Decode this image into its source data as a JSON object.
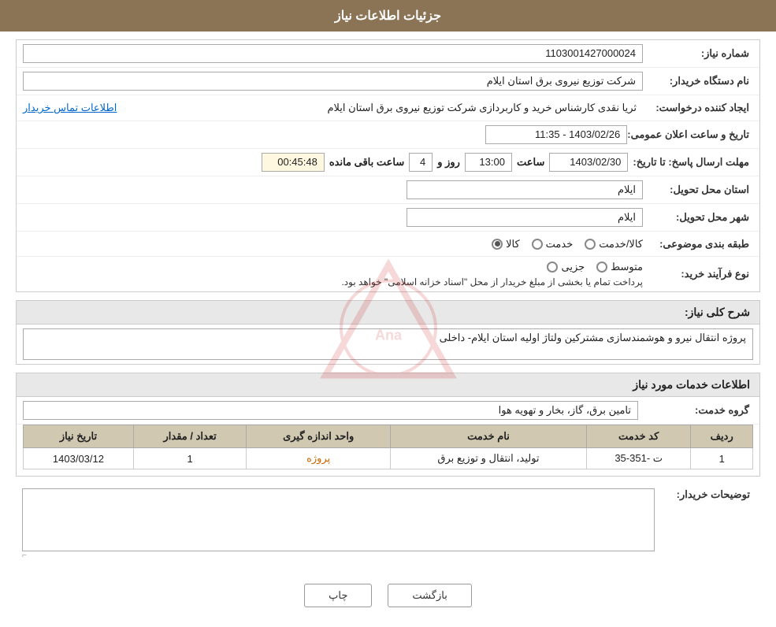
{
  "header": {
    "title": "جزئیات اطلاعات نیاز"
  },
  "main_info": {
    "need_number_label": "شماره نیاز:",
    "need_number_value": "1103001427000024",
    "buyer_org_label": "نام دستگاه خریدار:",
    "buyer_org_value": "شرکت توزیع نیروی برق استان ایلام",
    "created_by_label": "ایجاد کننده درخواست:",
    "created_by_value": "ثریا نقدی کارشناس خرید و کاربردازی شرکت توزیع نیروی برق استان ایلام",
    "contact_link": "اطلاعات تماس خریدار",
    "announce_date_label": "تاریخ و ساعت اعلان عمومی:",
    "announce_date_value": "1403/02/26 - 11:35",
    "response_deadline_label": "مهلت ارسال پاسخ: تا تاریخ:",
    "response_date": "1403/02/30",
    "response_time_label": "ساعت",
    "response_time": "13:00",
    "days_label": "روز و",
    "days_value": "4",
    "remaining_label": "ساعت باقی مانده",
    "remaining_time": "00:45:48",
    "province_label": "استان محل تحویل:",
    "province_value": "ایلام",
    "city_label": "شهر محل تحویل:",
    "city_value": "ایلام",
    "category_label": "طبقه بندی موضوعی:",
    "category_options": [
      "کالا",
      "خدمت",
      "کالا/خدمت"
    ],
    "category_selected": "کالا",
    "purchase_type_label": "نوع فرآیند خرید:",
    "purchase_types": [
      "جزیی",
      "متوسط"
    ],
    "purchase_note": "پرداخت تمام یا بخشی از مبلغ خریدار از محل \"اسناد خزانه اسلامی\" خواهد بود.",
    "description_label": "شرح کلی نیاز:",
    "description_value": "پروژه انتقال نیرو و هوشمندسازی مشترکین ولتاژ اولیه استان ایلام- داخلی"
  },
  "services_section": {
    "title": "اطلاعات خدمات مورد نیاز",
    "service_group_label": "گروه خدمت:",
    "service_group_value": "تامین برق، گاز، بخار و تهویه هوا",
    "table": {
      "columns": [
        "ردیف",
        "کد خدمت",
        "نام خدمت",
        "واحد اندازه گیری",
        "تعداد / مقدار",
        "تاریخ نیاز"
      ],
      "rows": [
        {
          "row_num": "1",
          "service_code": "ت -351-35",
          "service_name": "تولید، انتقال و توزیع برق",
          "unit": "پروژه",
          "quantity": "1",
          "date": "1403/03/12"
        }
      ]
    }
  },
  "buyer_desc_label": "توضیحات خریدار:",
  "buyer_desc_value": "",
  "buttons": {
    "print_label": "چاپ",
    "back_label": "بازگشت"
  }
}
